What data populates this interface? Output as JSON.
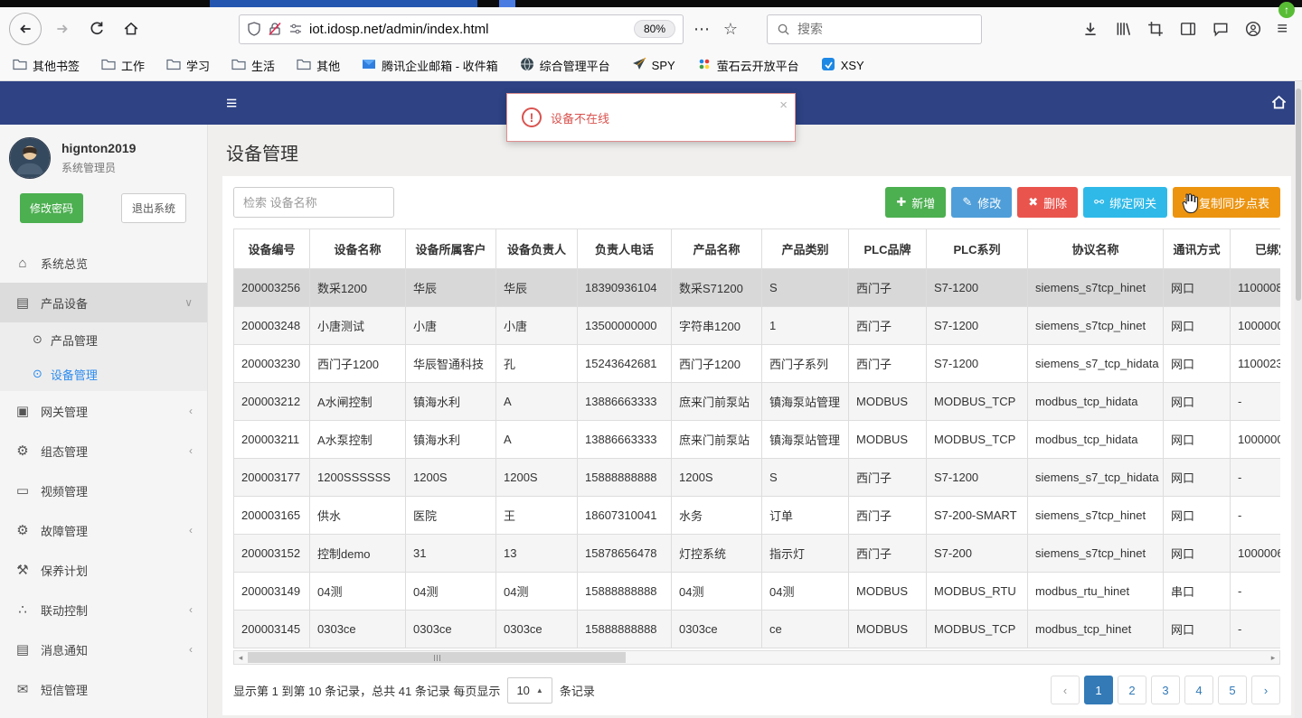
{
  "browser": {
    "toolbar": {
      "url": "iot.idosp.net/admin/index.html",
      "zoom_badge": "80%",
      "search_placeholder": "搜索"
    },
    "bookmarks": [
      {
        "label": "其他书签",
        "icon": "folder"
      },
      {
        "label": "工作",
        "icon": "folder"
      },
      {
        "label": "学习",
        "icon": "folder"
      },
      {
        "label": "生活",
        "icon": "folder"
      },
      {
        "label": "其他",
        "icon": "folder"
      },
      {
        "label": "腾讯企业邮箱 - 收件箱",
        "icon": "mail"
      },
      {
        "label": "综合管理平台",
        "icon": "globe"
      },
      {
        "label": "SPY",
        "icon": "dart"
      },
      {
        "label": "萤石云开放平台",
        "icon": "dots"
      },
      {
        "label": "XSY",
        "icon": "blue-square"
      }
    ]
  },
  "app": {
    "alert": {
      "text": "设备不在线",
      "close": "×"
    },
    "sidebar": {
      "username": "hignton2019",
      "role": "系统管理员",
      "buttons": {
        "change_password": "修改密码",
        "logout": "退出系统"
      },
      "menu": [
        {
          "label": "系统总览",
          "icon": "home"
        },
        {
          "label": "产品设备",
          "icon": "book",
          "state": "expanded",
          "children": [
            {
              "label": "产品管理",
              "icon": "dot"
            },
            {
              "label": "设备管理",
              "icon": "dot",
              "active": true
            }
          ]
        },
        {
          "label": "网关管理",
          "icon": "gateway",
          "chevron": true
        },
        {
          "label": "组态管理",
          "icon": "gears",
          "chevron": true
        },
        {
          "label": "视频管理",
          "icon": "screen"
        },
        {
          "label": "故障管理",
          "icon": "gears",
          "chevron": true
        },
        {
          "label": "保养计划",
          "icon": "wrench"
        },
        {
          "label": "联动控制",
          "icon": "sitemap",
          "chevron": true
        },
        {
          "label": "消息通知",
          "icon": "notebook",
          "chevron": true
        },
        {
          "label": "短信管理",
          "icon": "envelope"
        }
      ]
    },
    "main": {
      "title": "设备管理",
      "search_placeholder": "检索 设备名称",
      "actions": [
        {
          "label": "新增",
          "icon": "plus",
          "color": "#4caf50"
        },
        {
          "label": "修改",
          "icon": "pencil",
          "color": "#4f9ed9"
        },
        {
          "label": "删除",
          "icon": "cross",
          "color": "#e9544d"
        },
        {
          "label": "绑定网关",
          "icon": "link",
          "color": "#2fb9e8"
        },
        {
          "label": "复制同步点表",
          "icon": "sync",
          "color": "#ec9410"
        }
      ],
      "table": {
        "headers": [
          "设备编号",
          "设备名称",
          "设备所属客户",
          "设备负责人",
          "负责人电话",
          "产品名称",
          "产品类别",
          "PLC品牌",
          "PLC系列",
          "协议名称",
          "通讯方式",
          "已绑定网关"
        ],
        "selected_row": 0,
        "rows": [
          [
            "200003256",
            "数采1200",
            "华辰",
            "华辰",
            "18390936104",
            "数采S71200",
            "S",
            "西门子",
            "S7-1200",
            "siemens_s7tcp_hinet",
            "网口",
            "1100008"
          ],
          [
            "200003248",
            "小唐测试",
            "小唐",
            "小唐",
            "13500000000",
            "字符串1200",
            "1",
            "西门子",
            "S7-1200",
            "siemens_s7tcp_hinet",
            "网口",
            "1000000"
          ],
          [
            "200003230",
            "西门子1200",
            "华辰智通科技",
            "孔",
            "15243642681",
            "西门子1200",
            "西门子系列",
            "西门子",
            "S7-1200",
            "siemens_s7_tcp_hidata",
            "网口",
            "1100023"
          ],
          [
            "200003212",
            "A水闸控制",
            "镇海水利",
            "A",
            "13886663333",
            "庶来门前泵站",
            "镇海泵站管理",
            "MODBUS",
            "MODBUS_TCP",
            "modbus_tcp_hidata",
            "网口",
            "-"
          ],
          [
            "200003211",
            "A水泵控制",
            "镇海水利",
            "A",
            "13886663333",
            "庶来门前泵站",
            "镇海泵站管理",
            "MODBUS",
            "MODBUS_TCP",
            "modbus_tcp_hidata",
            "网口",
            "1000000"
          ],
          [
            "200003177",
            "1200SSSSSS",
            "1200S",
            "1200S",
            "15888888888",
            "1200S",
            "S",
            "西门子",
            "S7-1200",
            "siemens_s7_tcp_hidata",
            "网口",
            "-"
          ],
          [
            "200003165",
            "供水",
            "医院",
            "王",
            "18607310041",
            "水务",
            "订单",
            "西门子",
            "S7-200-SMART",
            "siemens_s7tcp_hinet",
            "网口",
            "-"
          ],
          [
            "200003152",
            "控制demo",
            "31",
            "13",
            "15878656478",
            "灯控系统",
            "指示灯",
            "西门子",
            "S7-200",
            "siemens_s7tcp_hinet",
            "网口",
            "1000006"
          ],
          [
            "200003149",
            "04测",
            "04测",
            "04测",
            "15888888888",
            "04测",
            "04测",
            "MODBUS",
            "MODBUS_RTU",
            "modbus_rtu_hinet",
            "串口",
            "-"
          ],
          [
            "200003145",
            "0303ce",
            "0303ce",
            "0303ce",
            "15888888888",
            "0303ce",
            "ce",
            "MODBUS",
            "MODBUS_TCP",
            "modbus_tcp_hinet",
            "网口",
            "-"
          ]
        ]
      },
      "pagination": {
        "info_prefix": "显示第 1 到第 10 条记录，总共 41 条记录 每页显示",
        "page_size": "10",
        "info_suffix": "条记录",
        "prev": "‹",
        "next": "›",
        "pages": [
          "1",
          "2",
          "3",
          "4",
          "5"
        ],
        "active_page": "1"
      }
    }
  }
}
